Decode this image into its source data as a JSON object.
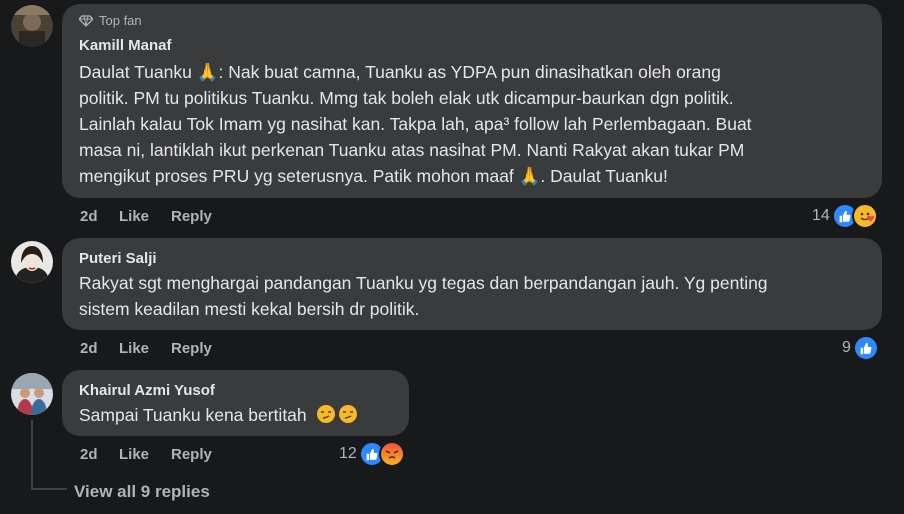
{
  "comments": [
    {
      "badge": "Top fan",
      "author": "Kamill Manaf",
      "text_lines": [
        "Daulat Tuanku 🙏: Nak buat camna, Tuanku as YDPA pun dinasihatkan oleh orang",
        "politik. PM tu politikus Tuanku. Mmg tak boleh elak utk dicampur-baurkan dgn politik.",
        "Lainlah kalau Tok Imam yg nasihat kan. Takpa lah, apa³ follow lah Perlembagaan. Buat",
        "masa ni, lantiklah ikut perkenan Tuanku atas nasihat PM. Nanti Rakyat akan tukar PM",
        "mengikut proses PRU yg seterusnya. Patik mohon maaf 🙏. Daulat Tuanku!"
      ],
      "time": "2d",
      "like": "Like",
      "reply": "Reply",
      "reaction_count": "14",
      "reactions": [
        "like-icon",
        "care-icon"
      ]
    },
    {
      "author": "Puteri Salji",
      "text_lines": [
        "Rakyat sgt menghargai pandangan Tuanku yg tegas dan berpandangan jauh. Yg penting",
        "sistem keadilan mesti kekal bersih dr politik."
      ],
      "time": "2d",
      "like": "Like",
      "reply": "Reply",
      "reaction_count": "9",
      "reactions": [
        "like-icon"
      ]
    },
    {
      "author": "Khairul Azmi Yusof",
      "text": "Sampai Tuanku kena bertitah",
      "time": "2d",
      "like": "Like",
      "reply": "Reply",
      "reaction_count": "12",
      "reactions": [
        "like-icon",
        "angry-icon"
      ]
    }
  ],
  "view_all_replies": "View all 9 replies",
  "colors": {
    "background": "#18191a",
    "bubble": "#3a3b3c",
    "text": "#e4e6eb",
    "secondary": "#b0b3b8",
    "like_blue": "#2e89ff"
  }
}
